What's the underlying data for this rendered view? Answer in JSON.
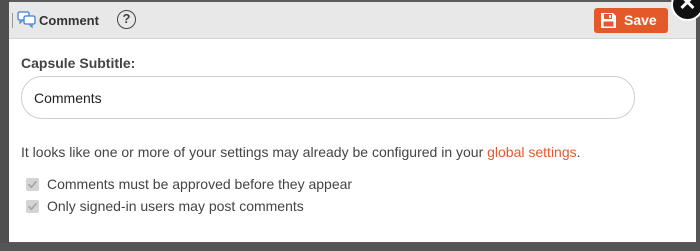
{
  "titlebar": {
    "title": "Comment",
    "help_icon": "?",
    "save_label": "Save",
    "close_glyph": "✕"
  },
  "form": {
    "subtitle_label": "Capsule Subtitle:",
    "subtitle_value": "Comments"
  },
  "notice": {
    "text": "It looks like one or more of your settings may already be configured in your ",
    "link": "global settings",
    "suffix": "."
  },
  "checkboxes": [
    {
      "label": "Comments must be approved before they appear",
      "checked": true,
      "disabled": true
    },
    {
      "label": "Only signed-in users may post comments",
      "checked": true,
      "disabled": true
    }
  ],
  "colors": {
    "accent": "#e4592a",
    "titlebar_bg": "#e8e8e8",
    "overlay": "#5b5b5b"
  },
  "icons": {
    "title": "comment-bubbles-icon",
    "help": "help-circle-icon",
    "save": "floppy-disk-icon",
    "close": "close-icon",
    "checkbox": "check-icon"
  }
}
